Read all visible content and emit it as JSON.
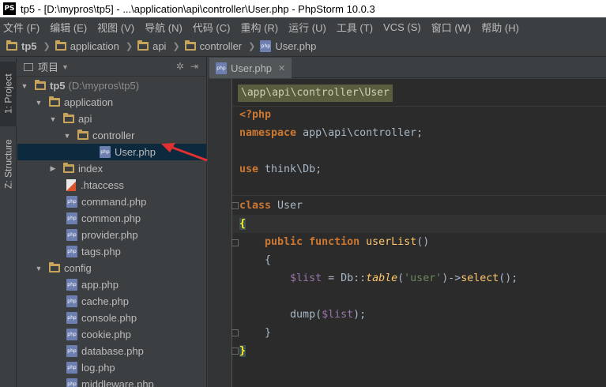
{
  "window": {
    "title": "tp5 - [D:\\mypros\\tp5] - ...\\application\\api\\controller\\User.php - PhpStorm 10.0.3",
    "logo": "PS"
  },
  "menu": [
    "文件 (F)",
    "编辑 (E)",
    "视图 (V)",
    "导航 (N)",
    "代码 (C)",
    "重构 (R)",
    "运行 (U)",
    "工具 (T)",
    "VCS (S)",
    "窗口 (W)",
    "帮助 (H)"
  ],
  "breadcrumb": [
    "tp5",
    "application",
    "api",
    "controller",
    "User.php"
  ],
  "toolwindows": {
    "project": "1: Project",
    "structure": "Z: Structure"
  },
  "project_panel": {
    "title": "项目"
  },
  "tree": {
    "root_name": "tp5",
    "root_path": "(D:\\mypros\\tp5)",
    "application": "application",
    "api": "api",
    "controller": "controller",
    "user_file": "User.php",
    "index": "index",
    "htaccess": ".htaccess",
    "command": "command.php",
    "common": "common.php",
    "provider": "provider.php",
    "tags": "tags.php",
    "config": "config",
    "app": "app.php",
    "cache": "cache.php",
    "console": "console.php",
    "cookie": "cookie.php",
    "database": "database.php",
    "log": "log.php",
    "middleware": "middleware.php"
  },
  "editor": {
    "tab": "User.php",
    "namespace_crumb": "\\app\\api\\controller\\User",
    "code": {
      "open_tag": "<?php",
      "kw_namespace": "namespace",
      "ns_value": " app\\api\\controller;",
      "kw_use": "use",
      "use_value": " think\\Db;",
      "kw_class": "class",
      "class_name": " User",
      "open_brace": "{",
      "kw_public": "public",
      "kw_function": "function",
      "fn_name": "userList",
      "fn_parens": "()",
      "method_open": "{",
      "var_list": "$list",
      "assign": " = Db::",
      "table_fn": "table",
      "paren_open": "(",
      "table_arg": "'user'",
      "chain": ")->",
      "select_fn": "select",
      "end_stmt": "();",
      "dump_fn": "dump(",
      "dump_arg": "$list",
      "dump_end": ");",
      "method_close": "}",
      "close_brace": "}"
    }
  },
  "colors": {
    "background": "#2b2b2b",
    "panel": "#3c3f41",
    "keyword": "#cc7832",
    "variable": "#9876aa",
    "string": "#6a8759",
    "function": "#ffc66d",
    "annotation_arrow": "#e03030",
    "selection": "#0d293e"
  }
}
